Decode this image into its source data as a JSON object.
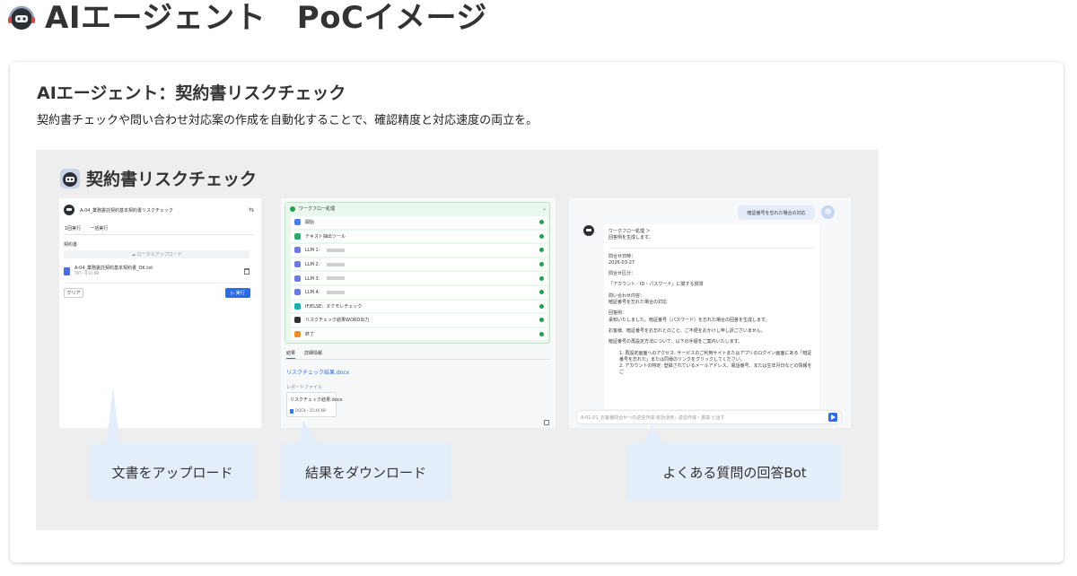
{
  "header": {
    "title": "AIエージェント　PoCイメージ",
    "logo_icon": "headset-robot-icon"
  },
  "card": {
    "title": "AIエージェント：契約書リスクチェック",
    "description": "契約書チェックや問い合わせ対応案の作成を自動化することで、確認精度と対応速度の両立を。"
  },
  "demo": {
    "title": "契約書リスクチェック",
    "title_icon": "robot-icon",
    "callouts": [
      "文書をアップロード",
      "結果をダウンロード",
      "よくある質問の回答Bot"
    ],
    "colors": {
      "accent": "#2e6ce6",
      "success": "#22a04b",
      "callout_bg": "#e4eefb"
    }
  },
  "panel_upload": {
    "app_name": "A-04_業務委託契約基本契約書リスクチェック",
    "tabs": [
      "1回実行",
      "一括実行"
    ],
    "field_label": "契約書",
    "upload_label": "ローカルアップロード",
    "file_name": "A-04_業務委託契約基本契約書_OK.txt",
    "file_meta": "TXT・4.91 KB",
    "clear_label": "クリア",
    "run_label": "▷ 実行"
  },
  "panel_workflow": {
    "header": "ワークフロー処理",
    "steps": [
      {
        "label": "開始",
        "color": "#4b7bec"
      },
      {
        "label": "テキスト抽出ツール",
        "color": "#2fa96b"
      },
      {
        "label": "LLM 1：",
        "color": "#6c7ae0"
      },
      {
        "label": "LLM 2：",
        "color": "#6c7ae0"
      },
      {
        "label": "LLM 3：",
        "color": "#6c7ae0"
      },
      {
        "label": "LLM 4：",
        "color": "#6c7ae0"
      },
      {
        "label": "IF/ELSE：ヌケモレチェック",
        "color": "#18b0b0"
      },
      {
        "label": "リスクチェック結果WORD出力",
        "color": "#333333"
      },
      {
        "label": "終了",
        "color": "#f08c2a"
      }
    ],
    "result_tabs": [
      "結果",
      "詳細情報"
    ],
    "result_link": "リスクチェック結果.docx",
    "report_label": "レポートファイル",
    "file_name": "リスクチェック結果.docx",
    "file_meta": "DOCX・15.46 KB"
  },
  "panel_chat": {
    "user_message": "暗証番号を忘れた場合の対応",
    "workflow_label": "ワークフロー処理 ＞",
    "answer_lines": [
      "回答例を生成します。",
      "問合せ日時：",
      "2026-03-27",
      "問合せ区分：",
      "「アカウント／ID・パスワード」に関する質問",
      "問い合わせ内容：",
      "暗証番号を忘れた場合の対応",
      "回答例：",
      "承知いたしました。暗証番号（パスワード）を忘れた場合の回答を生成します。",
      "お客様、暗証番号をお忘れとのこと、ご不便をおかけし申し訳ございません。",
      "暗証番号の再設定方法について、以下の手順をご案内いたします。",
      "1. 再設定画面へのアクセス: サービスのご利用サイトまたはアプリのログイン画面にある「暗証番号を忘れた」または同様のリンクをクリックしてください。",
      "2. アカウントの特定: 登録されているメールアドレス、電話番号、または生年月日などの情報をご"
    ],
    "input_placeholder": "A-01-01_お客様問合せへの返信作成-有効活用：返信作成・書換 と話す"
  }
}
